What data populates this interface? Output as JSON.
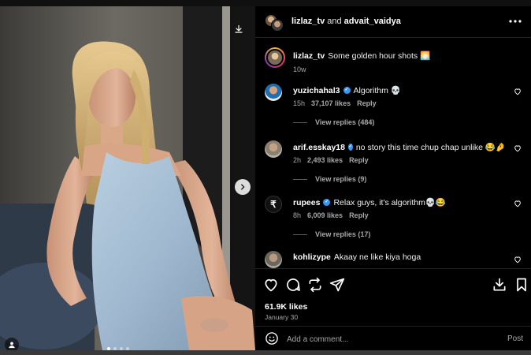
{
  "post": {
    "header": {
      "user1": "lizlaz_tv",
      "connector": "and",
      "user2": "advait_vaidya"
    },
    "caption": {
      "username": "lizlaz_tv",
      "text": "Some golden hour shots 🌅",
      "age": "10w"
    },
    "comments": [
      {
        "username": "yuzichahal3",
        "verified": true,
        "text": "Algorithm 💀",
        "age": "15h",
        "likes": "37,107 likes",
        "reply_label": "Reply",
        "replies_label": "View replies (484)"
      },
      {
        "username": "arif.esskay18",
        "verified": true,
        "text": "no story this time chup chap unlike 😂🤌",
        "age": "2h",
        "likes": "2,493 likes",
        "reply_label": "Reply",
        "replies_label": "View replies (9)"
      },
      {
        "username": "rupees",
        "verified": true,
        "text": "Relax guys, it's algorithm💀😂",
        "age": "8h",
        "likes": "6,009 likes",
        "reply_label": "Reply",
        "replies_label": "View replies (17)"
      },
      {
        "username": "kohlizype",
        "verified": false,
        "text": "Akaay ne like kiya hoga",
        "age": "",
        "likes": "",
        "reply_label": "",
        "replies_label": ""
      }
    ],
    "likes": "61.9K likes",
    "date": "January 30",
    "add_comment_placeholder": "Add a comment...",
    "post_label": "Post",
    "icons": {
      "download": "download-icon",
      "next": "chevron-right-icon",
      "tag": "user-tag-icon",
      "more": "more-icon",
      "like": "heart-icon",
      "comment": "comment-icon",
      "share": "repost-icon",
      "send": "send-icon",
      "download_action": "download-icon",
      "save": "bookmark-icon",
      "emoji": "emoji-icon"
    },
    "carousel": {
      "count": 4,
      "active_index": 0
    }
  },
  "colors": {
    "panel_bg": "#000000",
    "verified": "#3897f0",
    "muted_text": "#a8a8a8"
  }
}
